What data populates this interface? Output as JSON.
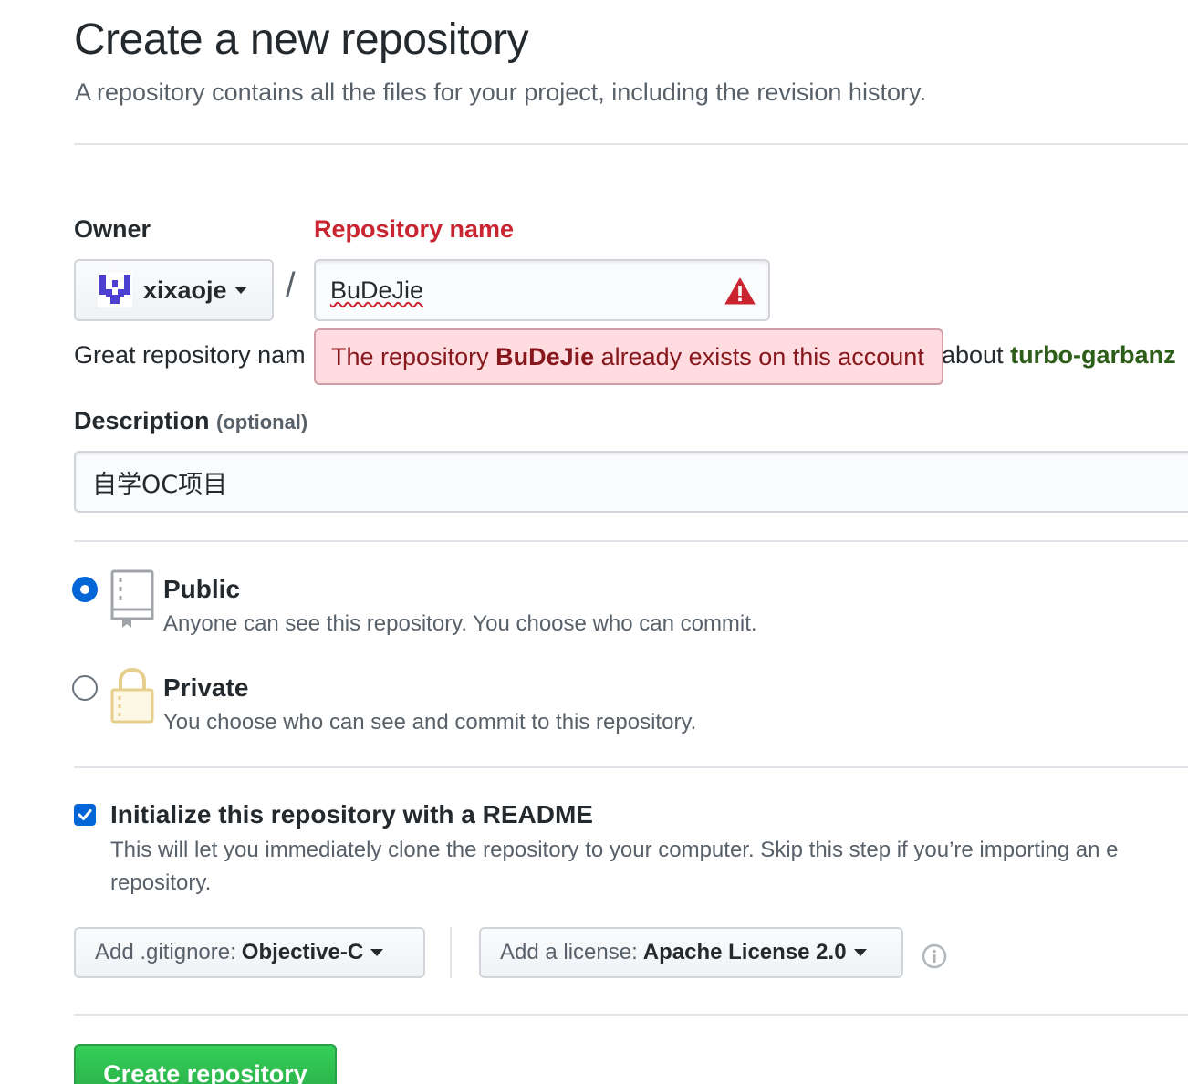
{
  "header": {
    "title": "Create a new repository",
    "subtitle": "A repository contains all the files for your project, including the revision history."
  },
  "owner": {
    "label": "Owner",
    "value": "xixaoje"
  },
  "repo_name": {
    "label": "Repository name",
    "value": "BuDeJie",
    "error_prefix": "The repository ",
    "error_name": "BuDeJie",
    "error_suffix": " already exists on this account"
  },
  "suggestion": {
    "left_text": "Great repository nam",
    "right_text": "about ",
    "suggested_name": "turbo-garbanz"
  },
  "description": {
    "label": "Description",
    "optional": "(optional)",
    "value": "自学OC项目"
  },
  "visibility": {
    "public_title": "Public",
    "public_desc": "Anyone can see this repository. You choose who can commit.",
    "private_title": "Private",
    "private_desc": "You choose who can see and commit to this repository.",
    "selected": "Public"
  },
  "readme": {
    "checked": true,
    "title": "Initialize this repository with a README",
    "desc_line1": "This will let you immediately clone the repository to your computer. Skip this step if you’re importing an e",
    "desc_line2": "repository."
  },
  "gitignore": {
    "prefix": "Add .gitignore:",
    "value": "Objective-C"
  },
  "license": {
    "prefix": "Add a license:",
    "value": "Apache License 2.0"
  },
  "submit": {
    "label": "Create repository"
  },
  "colors": {
    "error": "#cb2431",
    "accent": "#0366d6",
    "primary_button": "#28a745"
  },
  "icons": [
    "owner-avatar-icon",
    "warning-icon",
    "book-icon",
    "lock-icon",
    "checkbox-check-icon",
    "info-icon",
    "chevron-down-icon"
  ]
}
